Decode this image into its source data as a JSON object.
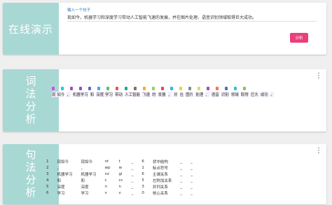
{
  "demo": {
    "side_label": "在线演示",
    "hint": "输入一个句子",
    "sentence": "现如今，机器学习和深度学习带动人工智能飞速的发展，并在图片处理、语音识别领域取得巨大成功。",
    "analyze_button": "分析"
  },
  "lexical": {
    "side_label": "词法分析",
    "more_icon": "⋮",
    "tag_colors": [
      "#e040fb",
      "#26c6da",
      "#ab47bc",
      "#7e57c2",
      "#5c6bc0",
      "#42a5f5",
      "#66bb6a",
      "#ef5350",
      "#26a69a",
      "#8d6e63",
      "#ffa726",
      "#9ccc65",
      "#ec407a",
      "#29b6f6",
      "#ffca28",
      "#78909c",
      "#d4e157",
      "#ab47bc",
      "#ff7043",
      "#5c6bc0",
      "#26c6da",
      "#8bc34a"
    ],
    "tokens": [
      "现 如今",
      "，",
      "机器学习",
      "和",
      "深度 学习",
      "带动",
      "人工智能",
      "飞速",
      "的",
      "发展",
      "，",
      "并",
      "在",
      "图片",
      "处理",
      "、",
      "语音",
      "识别",
      "领域",
      "取得",
      "巨大",
      "成功",
      "。"
    ]
  },
  "syntax": {
    "side_label": "句法分析",
    "more_icon": "⋮",
    "rows": [
      [
        "1",
        "现如今",
        "现如今",
        "nt",
        "t",
        "_",
        "6",
        "状中结构",
        "_",
        "_"
      ],
      [
        "2",
        "，",
        "，",
        "wp",
        "w",
        "_",
        "1",
        "标点符号",
        "_",
        "_"
      ],
      [
        "3",
        "机器学习",
        "机器学习",
        "nz",
        "gi",
        "_",
        "6",
        "主谓关系",
        "_",
        "_"
      ],
      [
        "4",
        "和",
        "和",
        "c",
        "cc",
        "_",
        "5",
        "左附加关系",
        "_",
        "_"
      ],
      [
        "5",
        "深度",
        "深度",
        "n",
        "n",
        "_",
        "3",
        "并列关系",
        "_",
        "_"
      ],
      [
        "6",
        "学习",
        "学习",
        "v",
        "v",
        "_",
        "0",
        "核心关系",
        "_",
        "_"
      ]
    ]
  }
}
